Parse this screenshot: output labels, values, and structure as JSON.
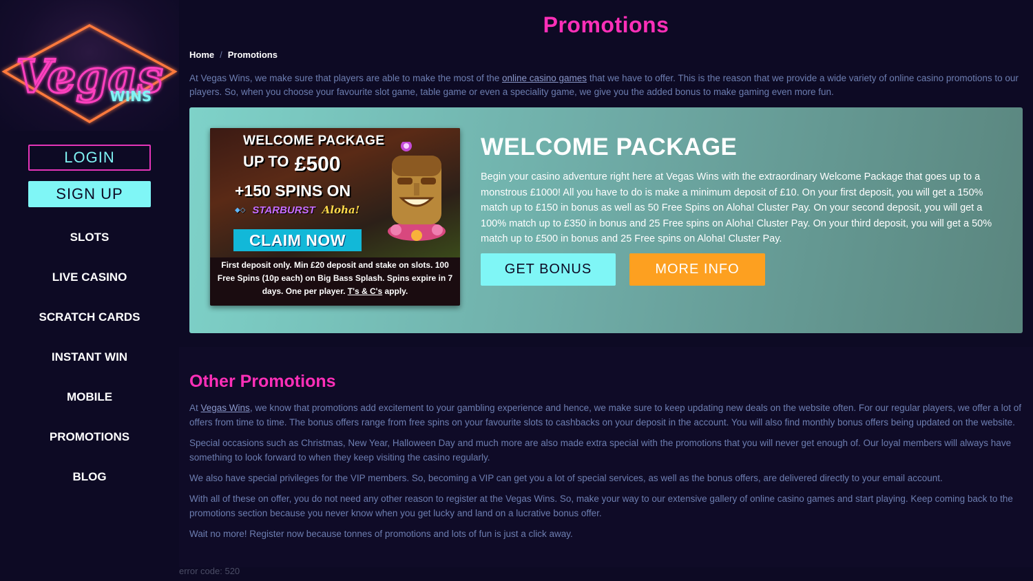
{
  "brand": {
    "logo_main": "Vegas",
    "logo_sub": "WINS"
  },
  "auth": {
    "login_label": "LOGIN",
    "signup_label": "SIGN UP"
  },
  "nav": {
    "items": [
      {
        "label": "SLOTS"
      },
      {
        "label": "LIVE CASINO"
      },
      {
        "label": "SCRATCH CARDS"
      },
      {
        "label": "INSTANT WIN"
      },
      {
        "label": "MOBILE"
      },
      {
        "label": "PROMOTIONS"
      },
      {
        "label": "BLOG"
      }
    ]
  },
  "page": {
    "title": "Promotions"
  },
  "breadcrumb": {
    "home": "Home",
    "separator": "/",
    "current": "Promotions"
  },
  "intro": {
    "before_link": "At Vegas Wins, we make sure that players are able to make the most of the ",
    "link": "online casino games",
    "after_link": " that we have to offer. This is the reason that we provide a wide variety of online casino promotions to our players. So, when you choose your favourite slot game, table game or even a speciality game, we give you the added bonus to make gaming even more fun."
  },
  "promo": {
    "banner": {
      "heading": "WELCOME PACKAGE",
      "amount_prefix": "UP TO",
      "amount": "£500",
      "spins": "+150 SPINS ON",
      "game1": "STARBURST",
      "game2": "Aloha!",
      "cta": "CLAIM NOW",
      "terms": "First deposit only. Min £20 deposit and stake on slots. 100 Free Spins (10p each) on Big Bass Splash. Spins expire in 7 days. One per player.",
      "terms_link": "T's & C's",
      "terms_end": "apply."
    },
    "title": "WELCOME PACKAGE",
    "description": "Begin your casino adventure right here at Vegas Wins with the extraordinary Welcome Package that goes up to a monstrous £1000! All you have to do is make a minimum deposit of £10. On your first deposit, you will get a 150% match up to £150 in bonus as well as 50 Free Spins on Aloha! Cluster Pay. On your second deposit, you will get a 100% match up to £350 in bonus and 25 Free spins on Aloha! Cluster Pay. On your third deposit, you will get a 50% match up to £500 in bonus and 25 Free spins on Aloha! Cluster Pay.",
    "get_bonus_label": "GET BONUS",
    "more_info_label": "MORE INFO"
  },
  "other": {
    "title": "Other Promotions",
    "p1_before": "At ",
    "p1_link": "Vegas Wins",
    "p1_after": ", we know that promotions add excitement to your gambling experience and hence, we make sure to keep updating new deals on the website often. For our regular players, we offer a lot of offers from time to time. The bonus offers range from free spins on your favourite slots to cashbacks on your deposit in the account. You will also find monthly bonus offers being updated on the website.",
    "p2": "Special occasions such as Christmas, New Year, Halloween Day and much more are also made extra special with the promotions that you will never get enough of. Our loyal members will always have something to look forward to when they keep visiting the casino regularly.",
    "p3": "We also have special privileges for the VIP members. So, becoming a VIP can get you a lot of special services, as well as the bonus offers, are delivered directly to your email account.",
    "p4": "With all of these on offer, you do not need any other reason to register at the Vegas Wins. So, make your way to our extensive gallery of online casino games and start playing. Keep coming back to the promotions section because you never know when you get lucky and land on a lucrative bonus offer.",
    "p5": "Wait no more! Register now because tonnes of promotions and lots of fun is just a click away."
  },
  "footer": {
    "error": "error code: 520"
  },
  "colors": {
    "background": "#0d0a24",
    "accent_pink": "#ff2fb8",
    "accent_cyan": "#7ff6f6",
    "accent_orange": "#fda020",
    "body_text": "#6d7eb1"
  }
}
